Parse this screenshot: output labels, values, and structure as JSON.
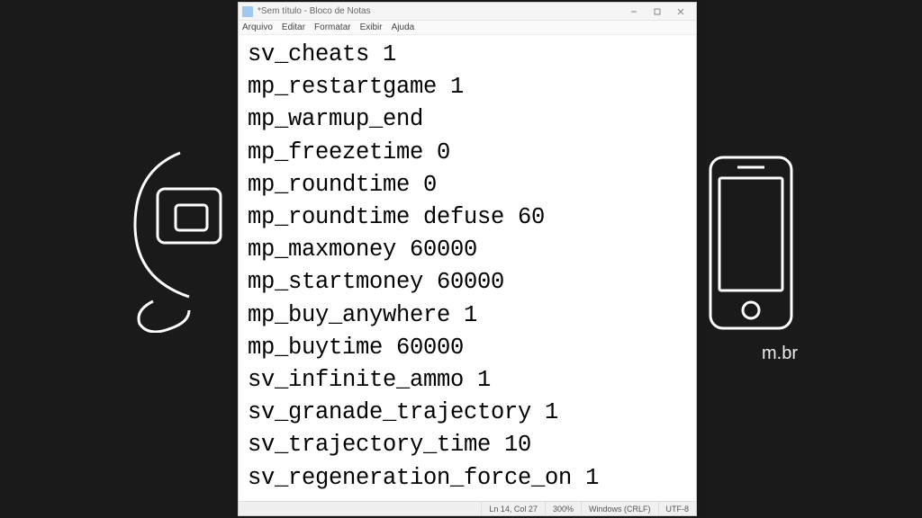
{
  "window": {
    "title": "*Sem título - Bloco de Notas"
  },
  "menu": {
    "file": "Arquivo",
    "edit": "Editar",
    "format": "Formatar",
    "view": "Exibir",
    "help": "Ajuda"
  },
  "content": "sv_cheats 1\nmp_restartgame 1\nmp_warmup_end\nmp_freezetime 0\nmp_roundtime 0\nmp_roundtime defuse 60\nmp_maxmoney 60000\nmp_startmoney 60000\nmp_buy_anywhere 1\nmp_buytime 60000\nsv_infinite_ammo 1\nsv_granade_trajectory 1\nsv_trajectory_time 10\nsv_regeneration_force_on 1",
  "status": {
    "cursor": "Ln 14, Col 27",
    "zoom": "300%",
    "line_ending": "Windows (CRLF)",
    "encoding": "UTF-8"
  },
  "background": {
    "domain_fragment": "m.br"
  }
}
